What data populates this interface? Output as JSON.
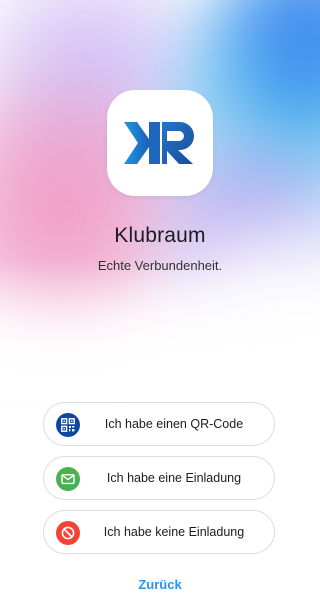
{
  "app": {
    "name": "Klubraum",
    "tagline": "Echte Verbundenheit.",
    "logo_text": "KR",
    "icon": "klubraum-logo"
  },
  "options": [
    {
      "label": "Ich habe einen QR-Code",
      "icon": "qr-code-icon",
      "color": "#0d47a1"
    },
    {
      "label": "Ich habe eine Einladung",
      "icon": "mail-icon",
      "color": "#4caf50"
    },
    {
      "label": "Ich habe keine Einladung",
      "icon": "block-icon",
      "color": "#f44336"
    }
  ],
  "back_label": "Zurück",
  "colors": {
    "accent": "#2196f3",
    "logo_gradient_start": "#1a9be0",
    "logo_gradient_end": "#1e4ea3"
  }
}
